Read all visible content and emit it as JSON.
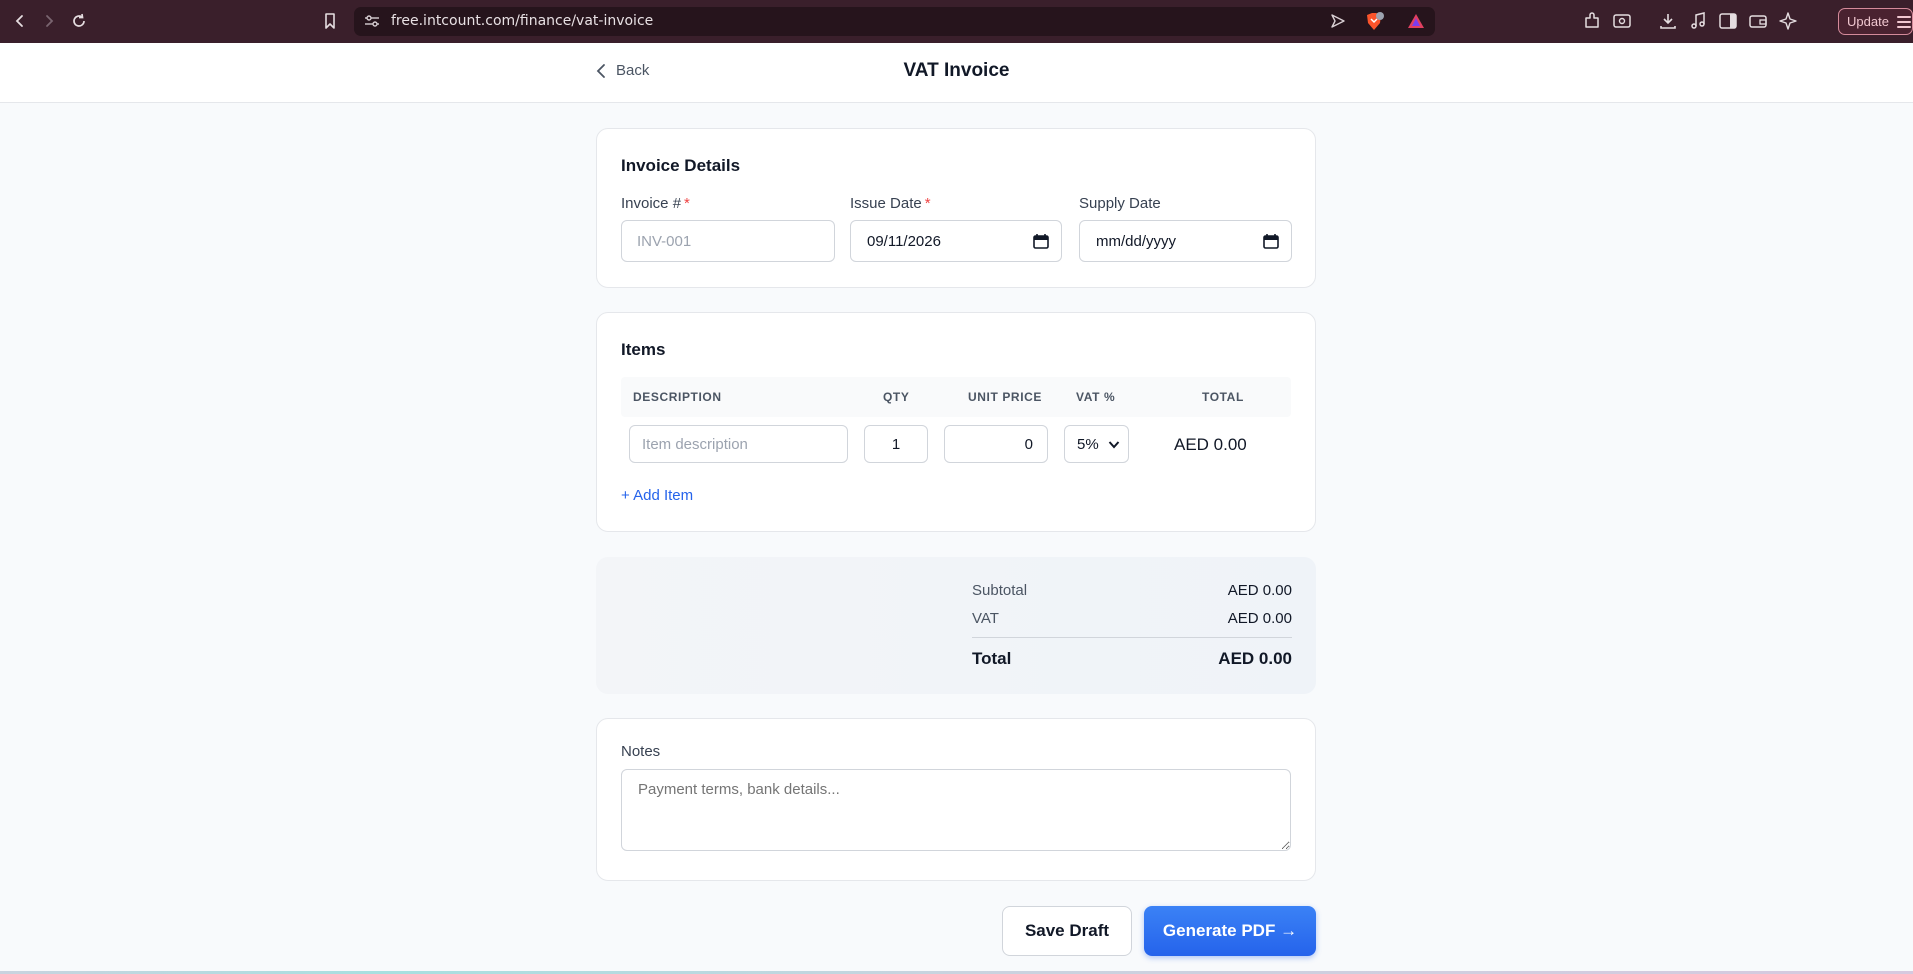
{
  "browser": {
    "url": "free.intcount.com/finance/vat-invoice",
    "update_label": "Update",
    "brave_badge": "1"
  },
  "header": {
    "back_label": "Back",
    "title": "VAT Invoice"
  },
  "invoice_details": {
    "heading": "Invoice Details",
    "invoice_number": {
      "label": "Invoice #",
      "required": "*",
      "placeholder": "INV-001",
      "value": ""
    },
    "issue_date": {
      "label": "Issue Date",
      "required": "*",
      "value": "09/11/2026"
    },
    "supply_date": {
      "label": "Supply Date",
      "placeholder": "mm/dd/yyyy",
      "value": ""
    }
  },
  "items": {
    "heading": "Items",
    "columns": [
      "DESCRIPTION",
      "QTY",
      "UNIT PRICE",
      "VAT %",
      "TOTAL"
    ],
    "rows": [
      {
        "description_placeholder": "Item description",
        "qty": "1",
        "unit_price": "0",
        "vat": "5%",
        "total": "AED 0.00"
      }
    ],
    "add_item_label": "+ Add Item"
  },
  "totals": {
    "subtotal_label": "Subtotal",
    "subtotal_value": "AED 0.00",
    "vat_label": "VAT",
    "vat_value": "AED 0.00",
    "total_label": "Total",
    "total_value": "AED 0.00"
  },
  "notes": {
    "label": "Notes",
    "placeholder": "Payment terms, bank details..."
  },
  "actions": {
    "save_draft": "Save Draft",
    "generate_pdf": "Generate PDF →"
  },
  "colors": {
    "accent": "#2563eb",
    "required": "#ef4444",
    "chrome": "#3a1f2b"
  }
}
